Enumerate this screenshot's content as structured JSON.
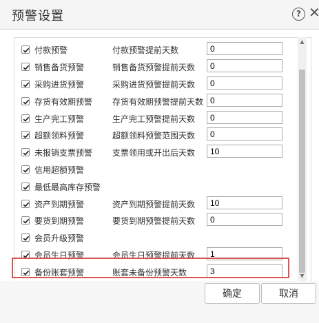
{
  "dialog": {
    "title": "预警设置",
    "help_icon": "question-circle-icon",
    "close_icon": "close-icon"
  },
  "rows": [
    {
      "label": "付款预警",
      "checked": true,
      "setting_label": "付款预警提前天数",
      "value": "0"
    },
    {
      "label": "销售备货预警",
      "checked": true,
      "setting_label": "销售备货预警提前天数",
      "value": "0"
    },
    {
      "label": "采购进货预警",
      "checked": true,
      "setting_label": "采购进货预警提前天数",
      "value": "0"
    },
    {
      "label": "存货有效期预警",
      "checked": true,
      "setting_label": "存货有效期预警提前天数",
      "value": "0"
    },
    {
      "label": "生产完工预警",
      "checked": true,
      "setting_label": "生产完工预警提前天数",
      "value": "0"
    },
    {
      "label": "超额领料预警",
      "checked": true,
      "setting_label": "超额领料预警范围天数",
      "value": "0"
    },
    {
      "label": "未报销支票预警",
      "checked": true,
      "setting_label": "支票领用或开出后天数",
      "value": "10"
    },
    {
      "label": "信用超额预警",
      "checked": true
    },
    {
      "label": "最低最高库存预警",
      "checked": true
    },
    {
      "label": "资产到期预警",
      "checked": true,
      "setting_label": "资产到期预警提前天数",
      "value": "10"
    },
    {
      "label": "要货到期预警",
      "checked": true,
      "setting_label": "要货到期预警提前天数",
      "value": "0"
    },
    {
      "label": "会员升级预警",
      "checked": true
    },
    {
      "label": "会员生日预警",
      "checked": true,
      "setting_label": "会员生日预警提前天数",
      "value": "1"
    },
    {
      "label": "备份账套预警",
      "checked": true,
      "setting_label": "账套未备份预警天数",
      "value": "3"
    }
  ],
  "footer": {
    "ok_label": "确定",
    "cancel_label": "取消"
  },
  "colors": {
    "highlight_border": "#d9534f"
  }
}
